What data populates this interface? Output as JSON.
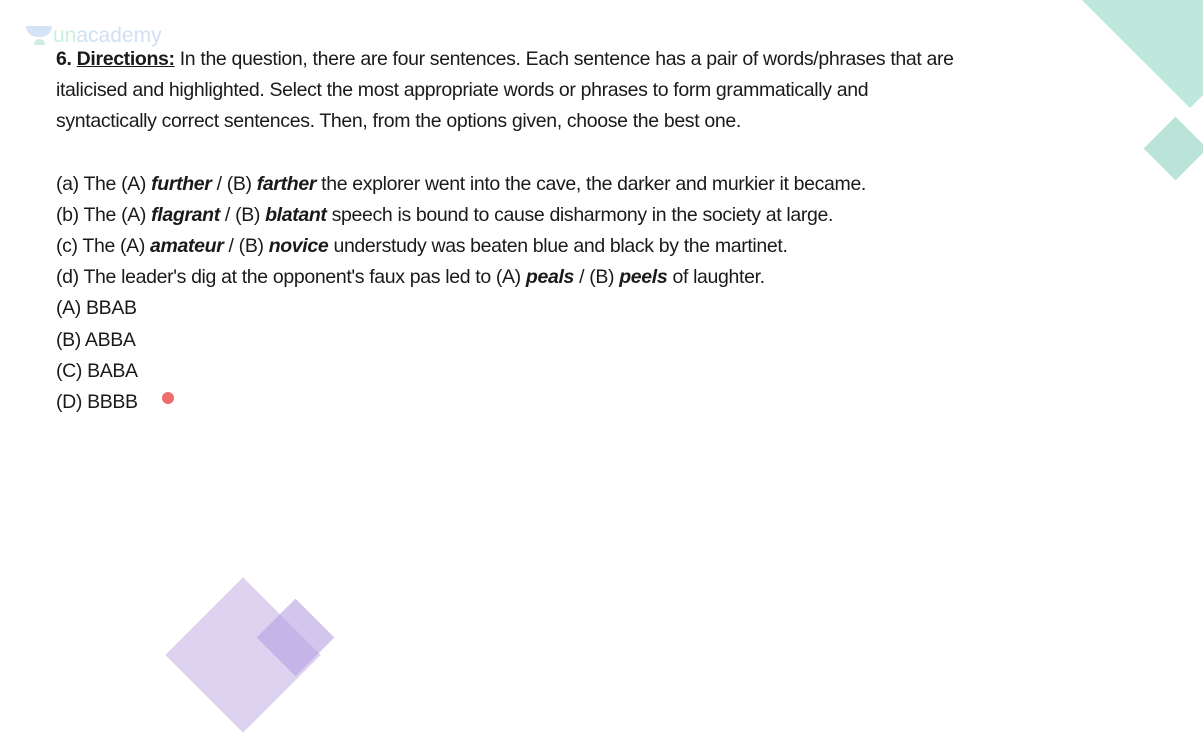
{
  "logo": {
    "text_a": "un",
    "text_b": "academy"
  },
  "question": {
    "number": "6.",
    "directions_label": "Directions:",
    "directions_text": " In the question, there are four sentences. Each sentence has a pair of words/phrases that are italicised and highlighted. Select the most appropriate words or phrases to form grammatically and syntactically correct sentences. Then, from the options given, choose the best one.",
    "sentences": [
      {
        "pre": "(a) The (A) ",
        "a": "further",
        "mid": " / (B) ",
        "b": "farther",
        "post": " the explorer went into the cave, the darker and murkier it became."
      },
      {
        "pre": "(b) The (A) ",
        "a": "flagrant",
        "mid": " / (B) ",
        "b": "blatant",
        "post": " speech is bound to cause disharmony in the society at large."
      },
      {
        "pre": "(c) The (A) ",
        "a": "amateur",
        "mid": " / (B) ",
        "b": "novice",
        "post": " understudy was beaten blue and black by the martinet."
      },
      {
        "pre": "(d) The leader's dig at the opponent's faux pas led to (A) ",
        "a": "peals",
        "mid": " / (B) ",
        "b": "peels",
        "post": " of laughter."
      }
    ],
    "options": [
      "(A) BBAB",
      "(B) ABBA",
      "(C) BABA",
      "(D) BBBB"
    ]
  },
  "colors": {
    "green_shape": "#bfe8dc",
    "purple_shape": "#d8cdee"
  }
}
